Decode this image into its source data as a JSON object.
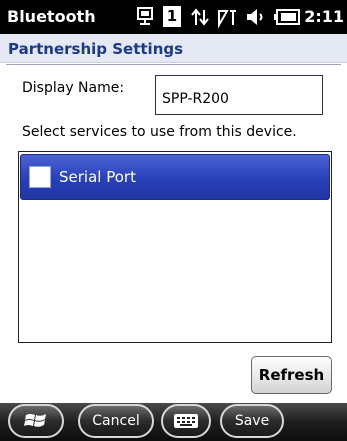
{
  "statusbar": {
    "app_name": "Bluetooth",
    "time": "2:11",
    "icons": [
      "device-sync-icon",
      "notification-count-icon",
      "data-transfer-icon",
      "signal-icon",
      "volume-icon",
      "battery-icon"
    ],
    "notification_count": "1"
  },
  "header": {
    "title": "Partnership Settings"
  },
  "form": {
    "display_name_label": "Display Name:",
    "display_name_value": "SPP-R200",
    "instruction": "Select services to use from this device."
  },
  "services": [
    {
      "label": "Serial Port",
      "checked": false,
      "selected": true
    }
  ],
  "buttons": {
    "refresh": "Refresh"
  },
  "softkeys": {
    "left": "Cancel",
    "right": "Save"
  },
  "colors": {
    "selection": "#2840b8",
    "title_text": "#1c3a8c",
    "title_bg": "#e4e9f3"
  }
}
